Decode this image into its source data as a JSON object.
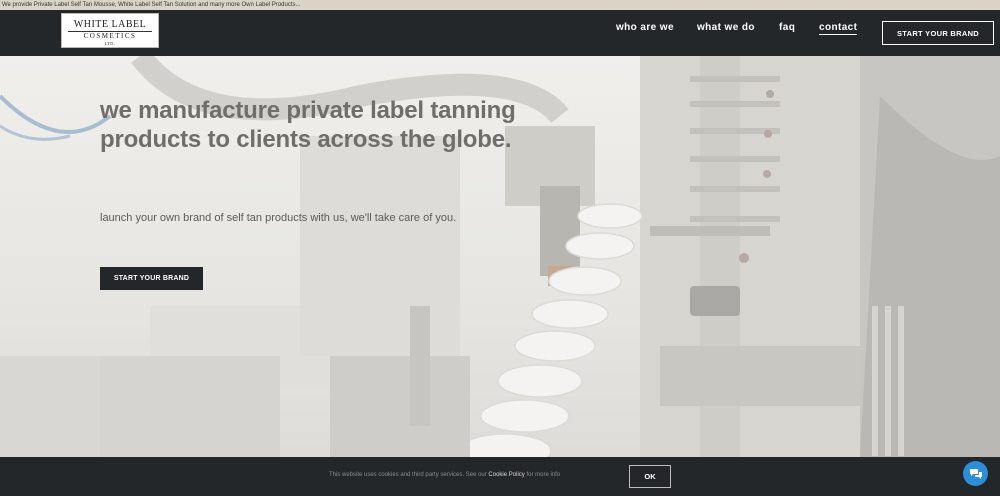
{
  "topbar": {
    "text": "We provide Private Label Self Tan Mousse, White Label Self Tan Solution and many more Own Label Products..."
  },
  "logo": {
    "line1": "WHITE LABEL",
    "line2": "COSMETICS",
    "line3": "LTD."
  },
  "nav": {
    "items": [
      {
        "label": "who are we"
      },
      {
        "label": "what we do"
      },
      {
        "label": "faq"
      },
      {
        "label": "contact"
      }
    ],
    "cta": "START YOUR BRAND"
  },
  "hero": {
    "title": "we manufacture private label tanning products to clients across the globe.",
    "subtitle": "launch your own brand of self tan products with us, we'll take care of you.",
    "cta": "START YOUR BRAND"
  },
  "cookie": {
    "text_before": "This website uses cookies and third party services. See our ",
    "link": "Cookie Policy",
    "text_after": " for more info",
    "ok": "OK"
  },
  "colors": {
    "header_bg": "#23272a",
    "chat_bubble": "#2b8ed6",
    "topbar_bg": "#d9d5c6"
  },
  "icons": {
    "chat": "chat-bubble-icon"
  }
}
